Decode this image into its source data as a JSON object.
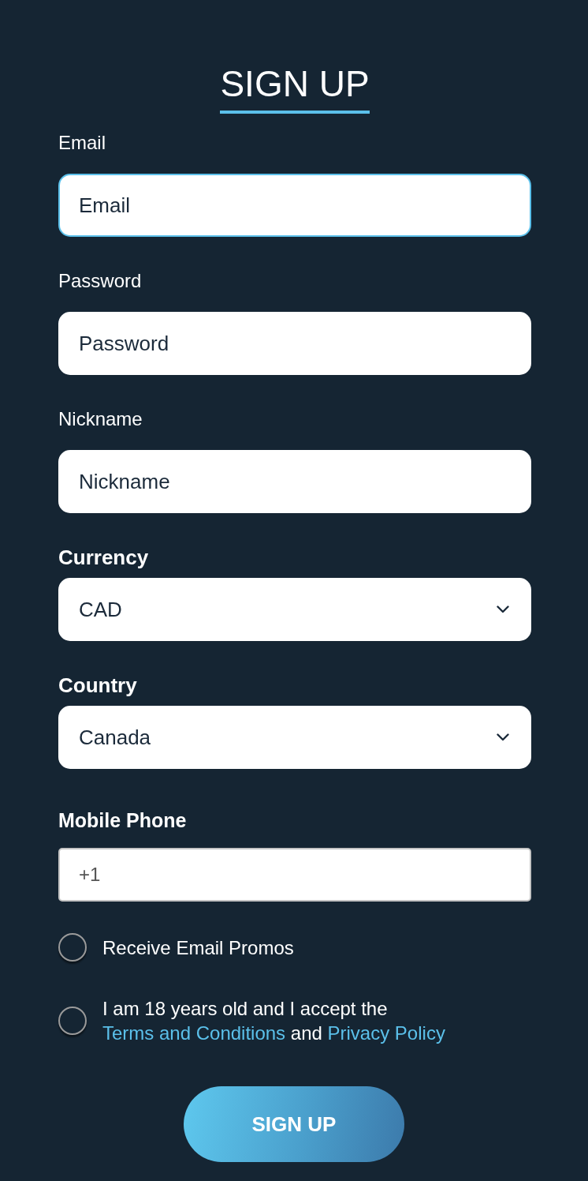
{
  "title": "SIGN UP",
  "fields": [
    {
      "kind": "text",
      "label": "Email",
      "placeholder": "Email",
      "focused": true
    },
    {
      "kind": "text",
      "label": "Password",
      "placeholder": "Password",
      "focused": false
    },
    {
      "kind": "text",
      "label": "Nickname",
      "placeholder": "Nickname",
      "focused": false
    },
    {
      "kind": "select",
      "label": "Currency",
      "value": "CAD",
      "focused": false
    },
    {
      "kind": "select",
      "label": "Country",
      "value": "Canada",
      "focused": false
    },
    {
      "kind": "phone",
      "label": "Mobile Phone",
      "value": "+1",
      "focused": false
    }
  ],
  "options": [
    {
      "checked": false,
      "parts": [
        {
          "kind": "text",
          "text": "Receive Email Promos"
        }
      ]
    },
    {
      "checked": false,
      "parts": [
        {
          "kind": "text",
          "text": "I am 18 years old and I accept the "
        },
        {
          "kind": "link",
          "text": "Terms and Conditions"
        },
        {
          "kind": "text",
          "text": " and "
        },
        {
          "kind": "link",
          "text": "Privacy Policy"
        }
      ]
    }
  ],
  "submit": "SIGN UP"
}
